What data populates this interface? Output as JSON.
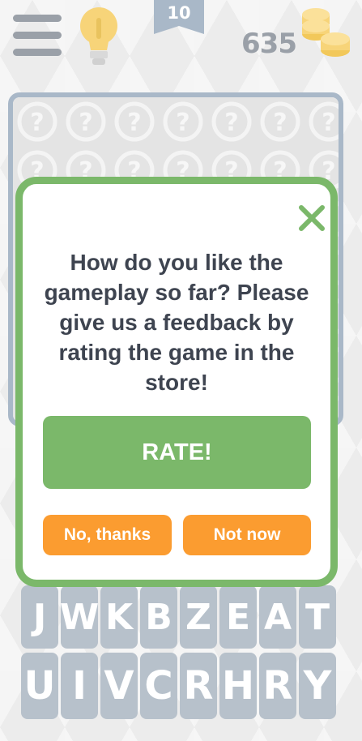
{
  "header": {
    "level": "10",
    "coins": "635",
    "menu_icon": "hamburger-menu-icon",
    "hint_icon": "lightbulb-icon",
    "coins_icon": "coin-stack-icon"
  },
  "dialog": {
    "message": "How do you like the gameplay so far? Please give us a feedback by rating the game in the store!",
    "rate_label": "RATE!",
    "no_thanks_label": "No, thanks",
    "not_now_label": "Not now",
    "close_icon": "close-icon"
  },
  "keyboard": {
    "row1": [
      "J",
      "W",
      "K",
      "B",
      "Z",
      "E",
      "A",
      "T"
    ],
    "row2": [
      "U",
      "I",
      "V",
      "C",
      "R",
      "H",
      "R",
      "Y"
    ]
  },
  "colors": {
    "accent_green": "#7bb86a",
    "button_orange": "#fb9c30",
    "text_dark": "#3e4450",
    "muted_gray": "#9aa0a8",
    "coin_gold": "#f7d479"
  }
}
